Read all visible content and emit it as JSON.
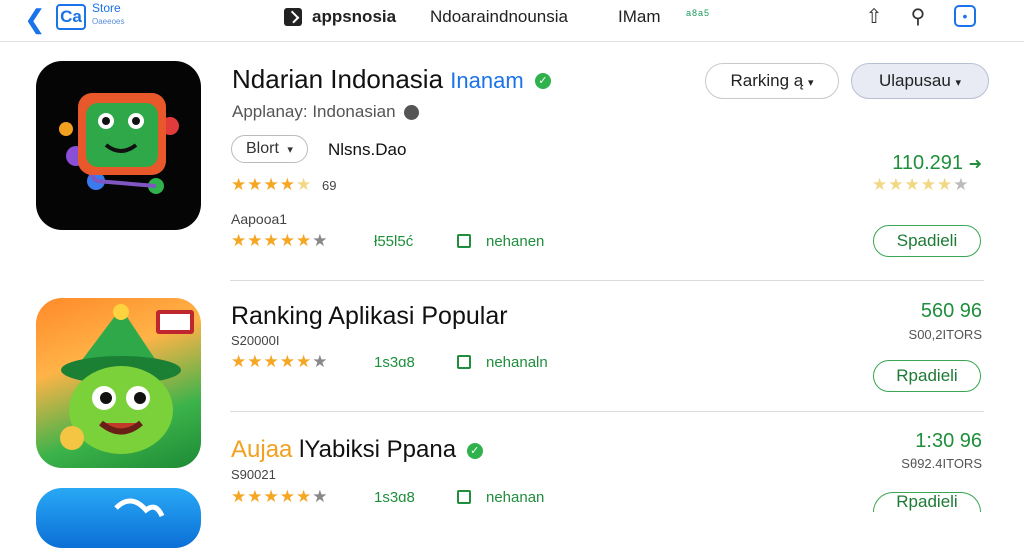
{
  "topbar": {
    "back_icon": "chevron-left-icon",
    "store_logo": "Ca",
    "store_label": "Store",
    "store_sub": "Oaeeoes",
    "nav_title": "appsnosia",
    "nav_sub": "Ndoaraindnounsia",
    "nav_user": "IMam",
    "nav_badge": "a8a5",
    "share_icon": "share-icon",
    "pin_icon": "pin-icon",
    "square_icon": "bookmark-icon"
  },
  "featured": {
    "title": "Ndarian Indonasia",
    "title_accent": "Inanam",
    "subtitle": "Applanay: Indonasian",
    "chip_label": "Blort",
    "chip_extra": "Nlsns.Dao",
    "rating_count": "69",
    "label": "Aapooa1",
    "metric1": "ł55l5ć",
    "metric2": "nehanen",
    "sort_label": "Rarking ą",
    "filter_label": "Ulapusau",
    "count": "110.291",
    "action": "Spadieli"
  },
  "section_title": "Ranking Aplikasi Popular",
  "apps": [
    {
      "id_text": "S20000I",
      "metric1": "1s3ɑ8",
      "metric2": "nehanaln",
      "count": "560 96",
      "sub_count": "S00,2ITORS",
      "action": "Rpadieli"
    },
    {
      "title_accent": "Aujaa",
      "title": "lYabiksi Ppana",
      "id_text": "S90021",
      "metric1": "1s3ɑ8",
      "metric2": "nehanan",
      "count": "1:30 96",
      "sub_count": "Sθ92.4ITORS",
      "action": "Rpadieli"
    }
  ],
  "colors": {
    "accent": "#1a73e8",
    "green": "#1f8f3c",
    "star": "#f5a623"
  }
}
